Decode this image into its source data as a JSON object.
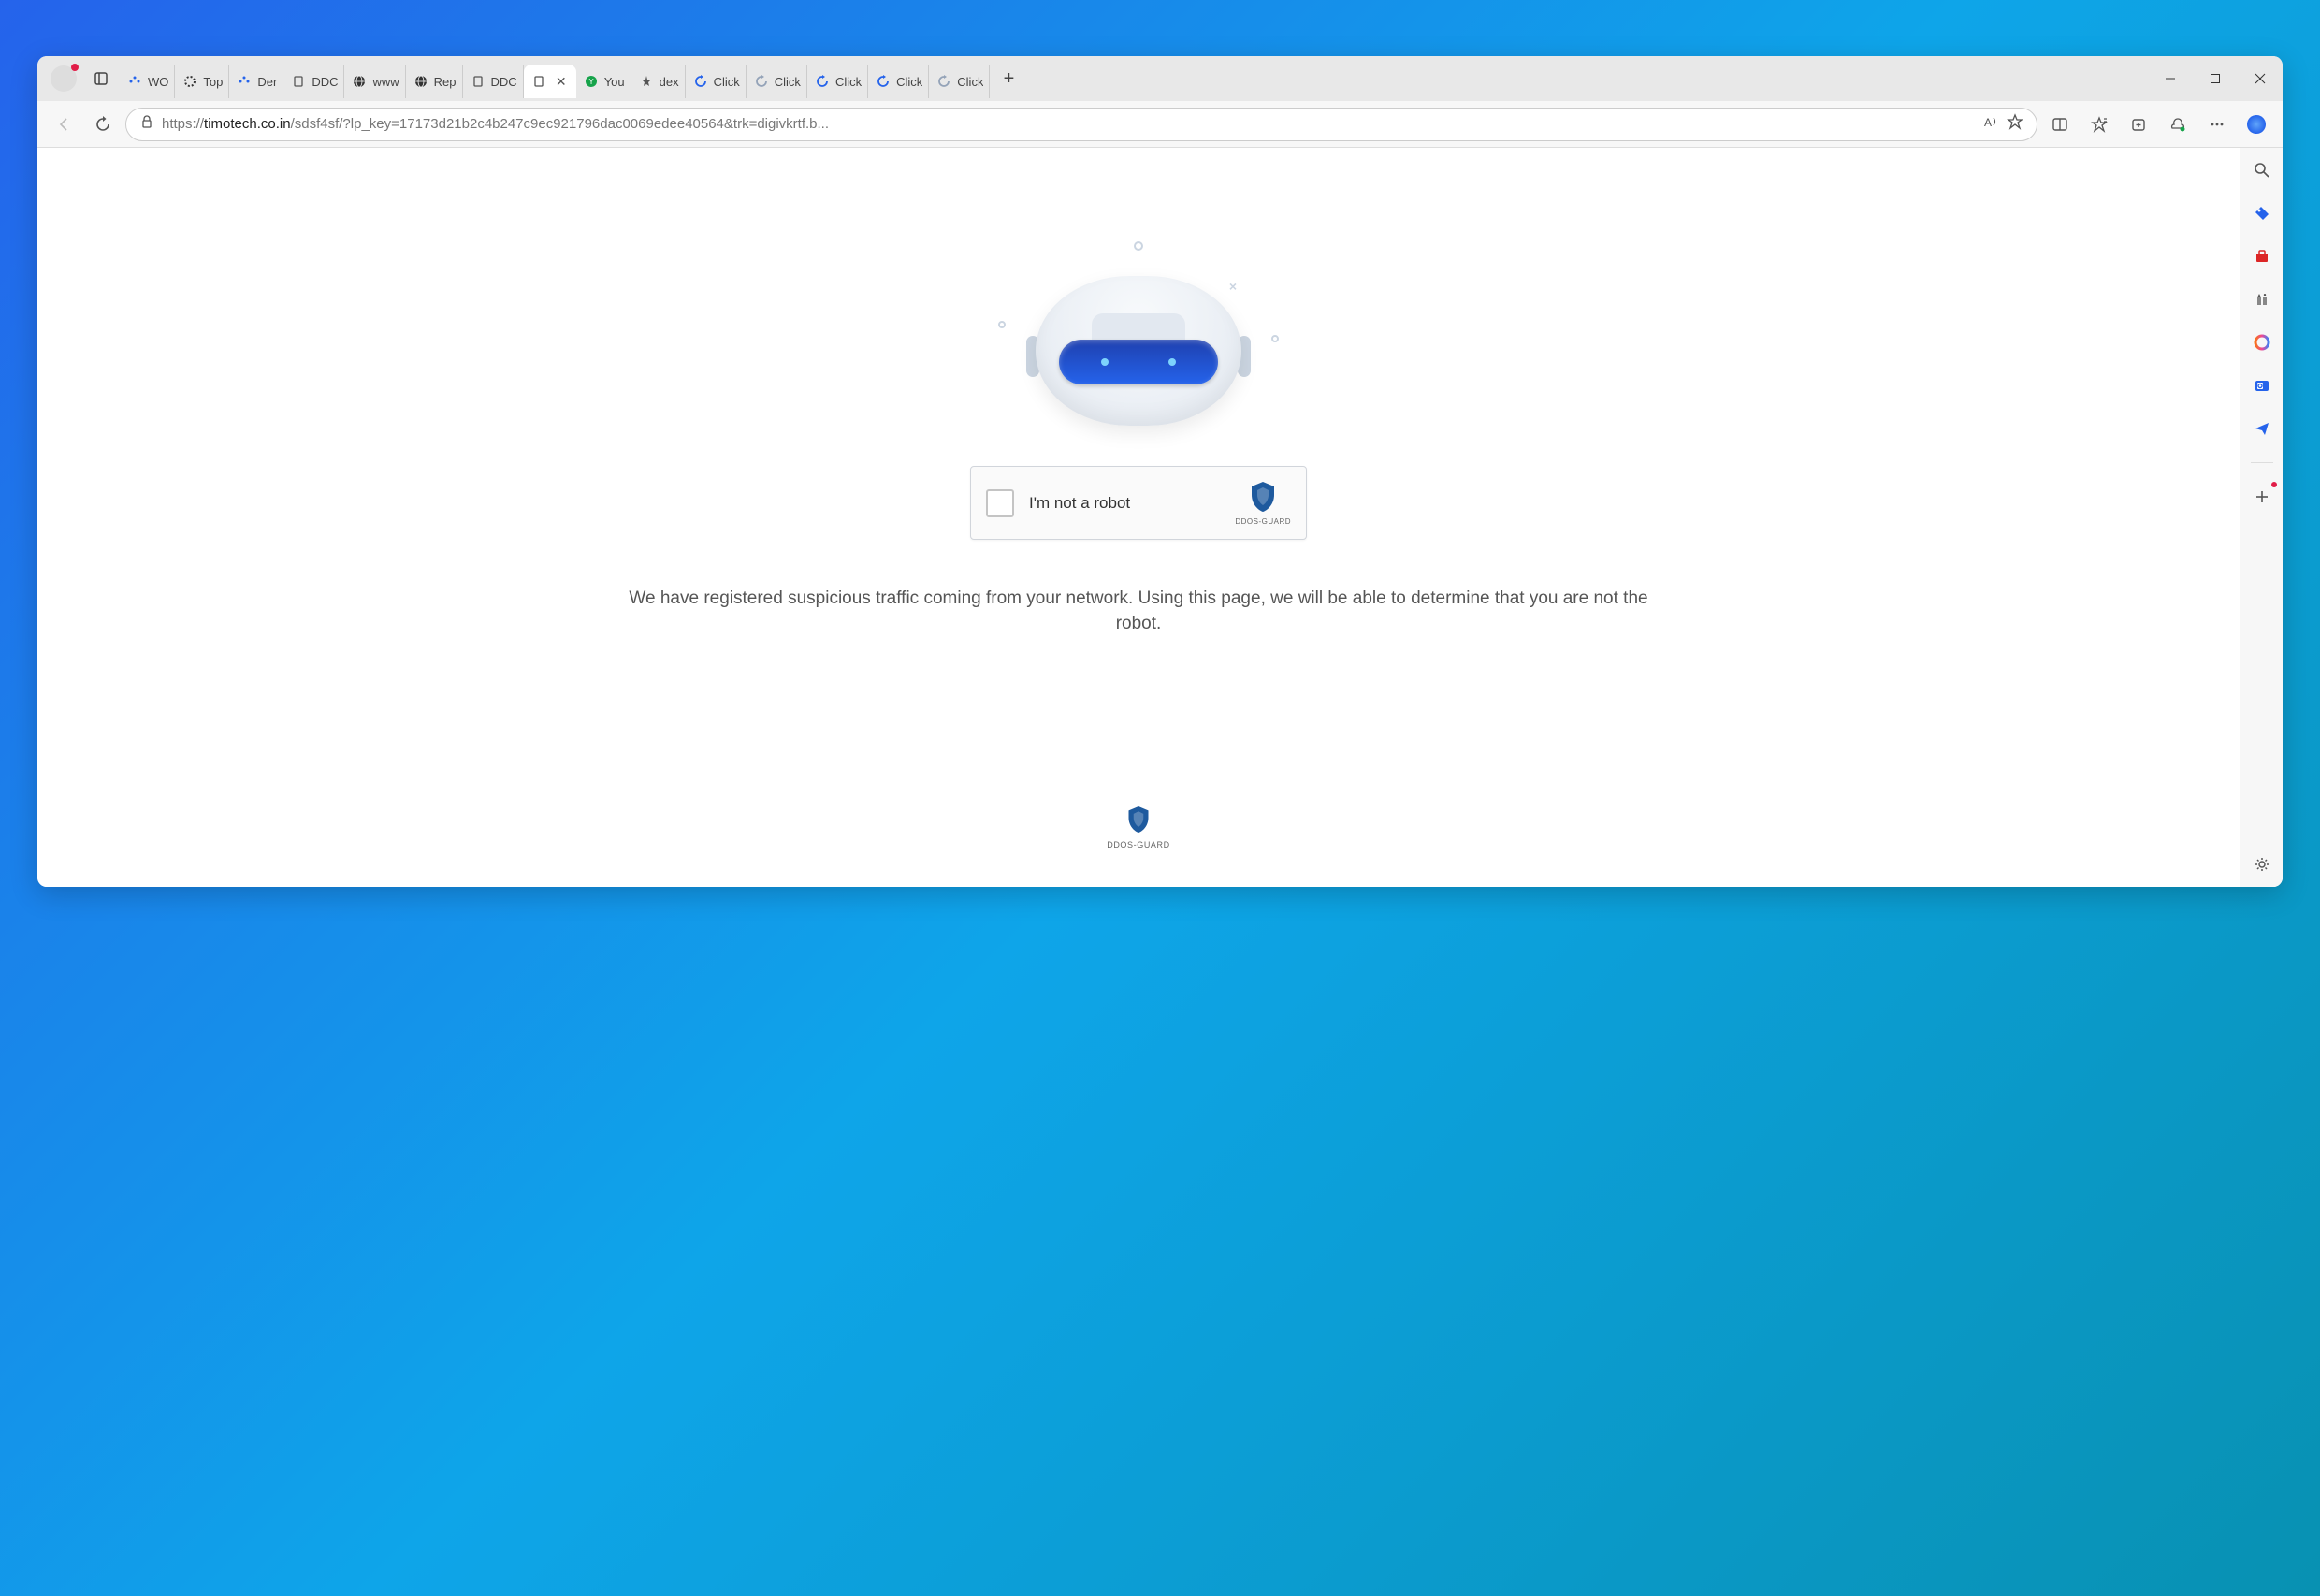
{
  "tabs": [
    {
      "label": "WO",
      "icon": "dots"
    },
    {
      "label": "Top",
      "icon": "spinner"
    },
    {
      "label": "Der",
      "icon": "dots"
    },
    {
      "label": "DDC",
      "icon": "page"
    },
    {
      "label": "www",
      "icon": "globe-dark"
    },
    {
      "label": "Rep",
      "icon": "globe-dark"
    },
    {
      "label": "DDC",
      "icon": "page"
    },
    {
      "label": "",
      "icon": "page",
      "active": true,
      "closeable": true
    },
    {
      "label": "You",
      "icon": "green-circle"
    },
    {
      "label": "dex",
      "icon": "sparkle"
    },
    {
      "label": "Click",
      "icon": "reload"
    },
    {
      "label": "Click",
      "icon": "reload-grey"
    },
    {
      "label": "Click",
      "icon": "reload"
    },
    {
      "label": "Click",
      "icon": "reload"
    },
    {
      "label": "Click",
      "icon": "reload-grey"
    }
  ],
  "url": {
    "prefix": "https://",
    "domain": "timotech.co.in",
    "path": "/sdsf4sf/?lp_key=17173d21b2c4b247c9ec921796dac0069edee40564&trk=digivkrtf.b..."
  },
  "captcha": {
    "label": "I'm not a robot",
    "brand": "DDOS-GUARD"
  },
  "message": "We have registered suspicious traffic coming from your network. Using this page, we will be able to determine that you are not the robot.",
  "footer_brand": "DDOS-GUARD"
}
